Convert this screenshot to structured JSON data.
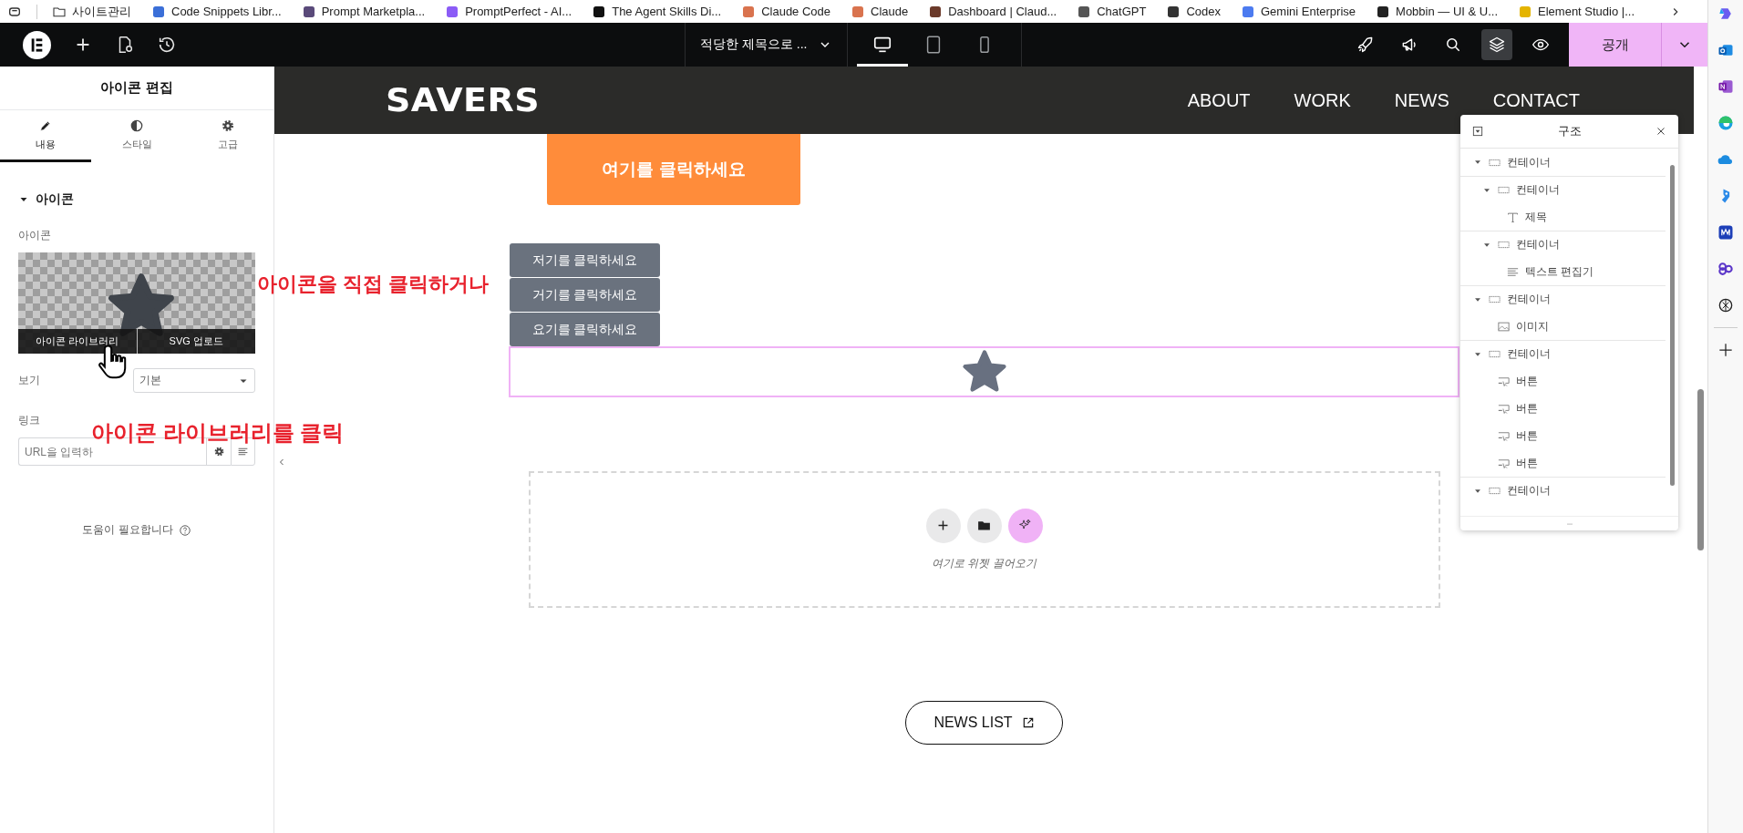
{
  "browser": {
    "bookmarks": [
      {
        "kind": "folder",
        "label": "사이트관리"
      },
      {
        "kind": "site",
        "label": "Code Snippets Libr..."
      },
      {
        "kind": "site",
        "label": "Prompt Marketpla..."
      },
      {
        "kind": "site",
        "label": "PromptPerfect - AI..."
      },
      {
        "kind": "site",
        "label": "The Agent Skills Di..."
      },
      {
        "kind": "site",
        "label": "Claude Code"
      },
      {
        "kind": "site",
        "label": "Claude"
      },
      {
        "kind": "site",
        "label": "Dashboard | Claud..."
      },
      {
        "kind": "site",
        "label": "ChatGPT"
      },
      {
        "kind": "site",
        "label": "Codex"
      },
      {
        "kind": "site",
        "label": "Gemini Enterprise"
      },
      {
        "kind": "site",
        "label": "Mobbin — UI & U..."
      },
      {
        "kind": "site",
        "label": "Element Studio |..."
      }
    ]
  },
  "toolbar": {
    "page_title": "적당한 제목으로 ...",
    "devices": [
      {
        "kind": "desktop",
        "selected": true
      },
      {
        "kind": "tablet",
        "selected": false
      },
      {
        "kind": "mobile",
        "selected": false
      }
    ],
    "tools": [
      {
        "kind": "rocket",
        "selected": false
      },
      {
        "kind": "megaphone",
        "selected": false
      },
      {
        "kind": "search",
        "selected": false
      },
      {
        "kind": "layers",
        "selected": true
      },
      {
        "kind": "eye",
        "selected": false
      }
    ],
    "publish_button": "공개"
  },
  "panel": {
    "title": "아이콘 편집",
    "tabs": [
      {
        "kind": "content",
        "label": "내용",
        "selected": true
      },
      {
        "kind": "style",
        "label": "스타일",
        "selected": false
      },
      {
        "kind": "advanced",
        "label": "고급",
        "selected": false
      }
    ],
    "section": {
      "title": "아이콘",
      "expanded": true
    },
    "icon_label": "아이콘",
    "icon_buttons": [
      "아이콘 라이브러리",
      "SVG 업로드"
    ],
    "view": {
      "label": "보기",
      "value": "기본"
    },
    "link": {
      "label": "링크",
      "placeholder": "URL을 입력하"
    },
    "help": "도움이 필요합니다"
  },
  "canvas": {
    "logo": "SAVERS",
    "nav": [
      "ABOUT",
      "WORK",
      "NEWS",
      "CONTACT"
    ],
    "primary_button": "여기를 클릭하세요",
    "buttons": [
      "저기를 클릭하세요",
      "거기를 클릭하세요",
      "요기를 클릭하세요"
    ],
    "drop_zone": {
      "hint": "여기로 위젯 끌어오기"
    },
    "news_button": "NEWS LIST"
  },
  "structure": {
    "title": "구조",
    "items": [
      {
        "kind": "container",
        "label": "컨테이너",
        "expanded": true,
        "children": [
          {
            "kind": "container",
            "label": "컨테이너",
            "expanded": true,
            "children": [
              {
                "kind": "heading",
                "label": "제목"
              }
            ]
          },
          {
            "kind": "container",
            "label": "컨테이너",
            "expanded": true,
            "children": [
              {
                "kind": "text",
                "label": "텍스트 편집기"
              }
            ]
          }
        ]
      },
      {
        "kind": "container",
        "label": "컨테이너",
        "expanded": true,
        "children": [
          {
            "kind": "image",
            "label": "이미지"
          }
        ]
      },
      {
        "kind": "container",
        "label": "컨테이너",
        "expanded": true,
        "children": [
          {
            "kind": "button",
            "label": "버튼"
          },
          {
            "kind": "button",
            "label": "버튼"
          },
          {
            "kind": "button",
            "label": "버튼"
          },
          {
            "kind": "button",
            "label": "버튼"
          }
        ]
      },
      {
        "kind": "container",
        "label": "컨테이너",
        "expanded": true
      }
    ]
  },
  "annotations": [
    {
      "text": "아이콘을 직접 클릭하거나"
    },
    {
      "text": "아이콘 라이브러리를 클릭"
    }
  ]
}
